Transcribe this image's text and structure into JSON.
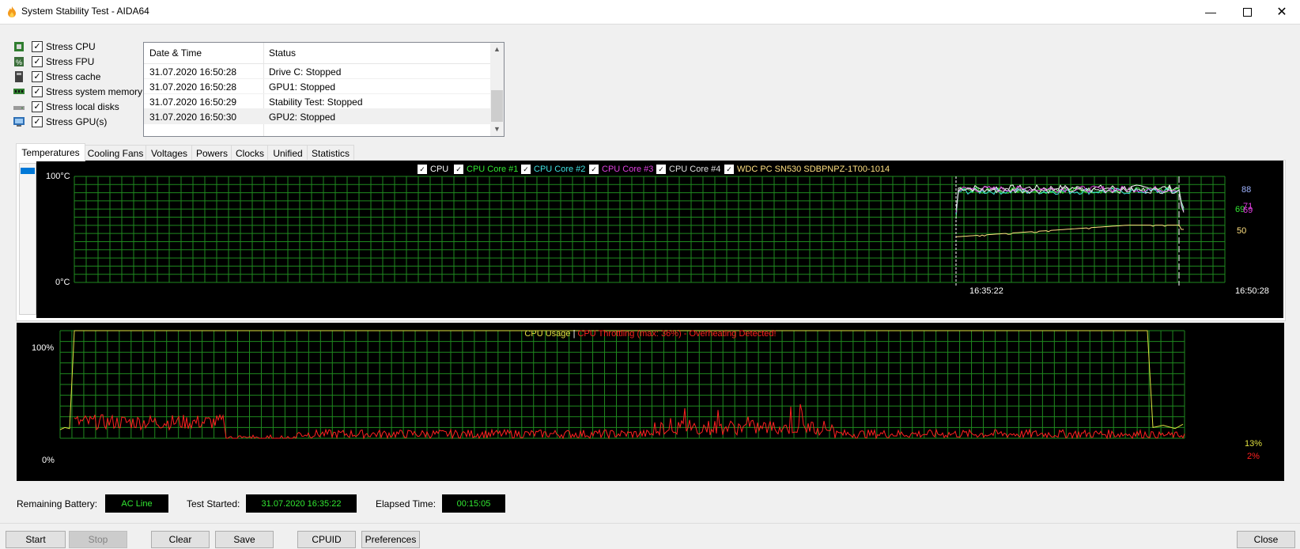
{
  "window": {
    "title": "System Stability Test - AIDA64"
  },
  "stress_options": [
    {
      "label": "Stress CPU",
      "checked": true,
      "icon": "cpu-icon"
    },
    {
      "label": "Stress FPU",
      "checked": true,
      "icon": "fpu-icon"
    },
    {
      "label": "Stress cache",
      "checked": true,
      "icon": "cache-icon"
    },
    {
      "label": "Stress system memory",
      "checked": true,
      "icon": "memory-icon"
    },
    {
      "label": "Stress local disks",
      "checked": true,
      "icon": "disk-icon"
    },
    {
      "label": "Stress GPU(s)",
      "checked": true,
      "icon": "gpu-icon"
    }
  ],
  "log": {
    "columns": [
      "Date & Time",
      "Status"
    ],
    "rows": [
      {
        "time": "31.07.2020 16:50:28",
        "status": "Drive C: Stopped"
      },
      {
        "time": "31.07.2020 16:50:28",
        "status": "GPU1: Stopped"
      },
      {
        "time": "31.07.2020 16:50:29",
        "status": "Stability Test: Stopped"
      },
      {
        "time": "31.07.2020 16:50:30",
        "status": "GPU2: Stopped"
      }
    ]
  },
  "tabs": [
    "Temperatures",
    "Cooling Fans",
    "Voltages",
    "Powers",
    "Clocks",
    "Unified",
    "Statistics"
  ],
  "temp_graph": {
    "legend": [
      {
        "label": "CPU",
        "color": "#ffffff"
      },
      {
        "label": "CPU Core #1",
        "color": "#32e832"
      },
      {
        "label": "CPU Core #2",
        "color": "#40e0e0"
      },
      {
        "label": "CPU Core #3",
        "color": "#e040e0"
      },
      {
        "label": "CPU Core #4",
        "color": "#e0e0e0"
      },
      {
        "label": "WDC PC SN530 SDBPNPZ-1T00-1014",
        "color": "#ffe080"
      }
    ],
    "y_max_label": "100°C",
    "y_min_label": "0°C",
    "x_labels": [
      "16:35:22",
      "16:50:28"
    ],
    "end_values": [
      {
        "text": "88",
        "color": "#9fb3ff"
      },
      {
        "text": "71",
        "color": "#e040e0"
      },
      {
        "text": "69",
        "color": "#32e832"
      },
      {
        "text": "69",
        "color": "#e040e0"
      },
      {
        "text": "50",
        "color": "#ffe080"
      }
    ]
  },
  "usage_graph": {
    "title_left": "CPU Usage",
    "separator": "|",
    "title_right": "CPU Throttling (max: 36%) - Overheating Detected!",
    "y_max_label": "100%",
    "y_min_label": "0%",
    "end_values": [
      {
        "text": "13%",
        "color": "#e0e040"
      },
      {
        "text": "2%",
        "color": "#ff2020"
      }
    ]
  },
  "status": {
    "battery_label": "Remaining Battery:",
    "battery_value": "AC Line",
    "started_label": "Test Started:",
    "started_value": "31.07.2020 16:35:22",
    "elapsed_label": "Elapsed Time:",
    "elapsed_value": "00:15:05"
  },
  "buttons": {
    "start": "Start",
    "stop": "Stop",
    "clear": "Clear",
    "save": "Save",
    "cpuid": "CPUID",
    "preferences": "Preferences",
    "close": "Close"
  },
  "colors": {
    "grid": "#1f8a1f",
    "background": "#000000",
    "usage_line": "#e0e040",
    "throttle_line": "#ff2020"
  }
}
